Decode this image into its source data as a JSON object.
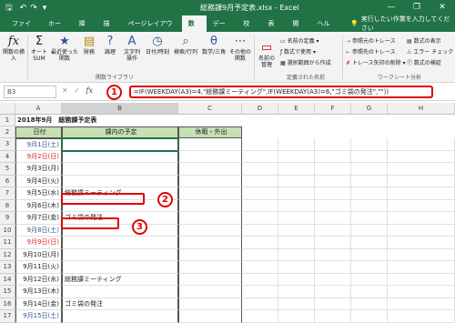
{
  "window": {
    "title": "総務課9月予定表.xlsx - Excel",
    "minimize": "—",
    "restore": "❐",
    "close": "✕"
  },
  "tabs": [
    "ファイル",
    "ホーム",
    "挿入",
    "描画",
    "ページレイアウト",
    "数式",
    "データ",
    "校閲",
    "表示",
    "開発",
    "ヘルプ"
  ],
  "active_tab": "数式",
  "tellme": "実行したい作業を入力してください",
  "ribbon": {
    "insert_function": "関数の挿入",
    "autosum": "オート SUM",
    "recent": "最近使った 関数",
    "financial": "財務",
    "logical": "論理",
    "text": "文字列 操作",
    "datetime": "日付/時刻",
    "lookup": "検索/行列",
    "math": "数学/三角",
    "more": "その他の 関数",
    "group_library": "関数ライブラリ",
    "name_manager": "名前の 管理",
    "define_name": "名前の定義",
    "use_in_formula": "数式で使用",
    "create_from_sel": "選択範囲から作成",
    "group_names": "定義された名前",
    "trace_precedents": "参照元のトレース",
    "trace_dependents": "参照先のトレース",
    "remove_arrows": "トレース矢印の削除",
    "show_formulas": "数式の表示",
    "error_check": "エラー チェック",
    "evaluate": "数式の検証",
    "group_audit": "ワークシート分析"
  },
  "formula_bar": {
    "name_box": "B3",
    "formula": "=IF(WEEKDAY(A3)=4,\"総務課ミーティング\",IF(WEEKDAY(A3)=6,\"ゴミ袋の発注\",\"\"))"
  },
  "columns": [
    "A",
    "B",
    "C",
    "D",
    "E",
    "F",
    "G",
    "H"
  ],
  "sheet": {
    "title": "2018年9月　総務課予定表",
    "header_date": "日付",
    "header_plan": "課内の予定",
    "header_off": "休暇・外出",
    "rows": [
      {
        "num": "3",
        "date": "9月1日(土)",
        "plan": "",
        "day": "sat"
      },
      {
        "num": "4",
        "date": "9月2日(日)",
        "plan": "",
        "day": "sun"
      },
      {
        "num": "5",
        "date": "9月3日(月)",
        "plan": "",
        "day": ""
      },
      {
        "num": "6",
        "date": "9月4日(火)",
        "plan": "",
        "day": ""
      },
      {
        "num": "7",
        "date": "9月5日(水)",
        "plan": "総務課ミーティング",
        "day": ""
      },
      {
        "num": "8",
        "date": "9月6日(木)",
        "plan": "",
        "day": ""
      },
      {
        "num": "9",
        "date": "9月7日(金)",
        "plan": "ゴミ袋の発注",
        "day": ""
      },
      {
        "num": "10",
        "date": "9月8日(土)",
        "plan": "",
        "day": "sat"
      },
      {
        "num": "11",
        "date": "9月9日(日)",
        "plan": "",
        "day": "sun"
      },
      {
        "num": "12",
        "date": "9月10日(月)",
        "plan": "",
        "day": ""
      },
      {
        "num": "13",
        "date": "9月11日(火)",
        "plan": "",
        "day": ""
      },
      {
        "num": "14",
        "date": "9月12日(水)",
        "plan": "総務課ミーティング",
        "day": ""
      },
      {
        "num": "15",
        "date": "9月13日(木)",
        "plan": "",
        "day": ""
      },
      {
        "num": "16",
        "date": "9月14日(金)",
        "plan": "ゴミ袋の発注",
        "day": ""
      },
      {
        "num": "17",
        "date": "9月15日(土)",
        "plan": "",
        "day": "sat"
      }
    ]
  },
  "callouts": [
    "1",
    "2",
    "3"
  ]
}
